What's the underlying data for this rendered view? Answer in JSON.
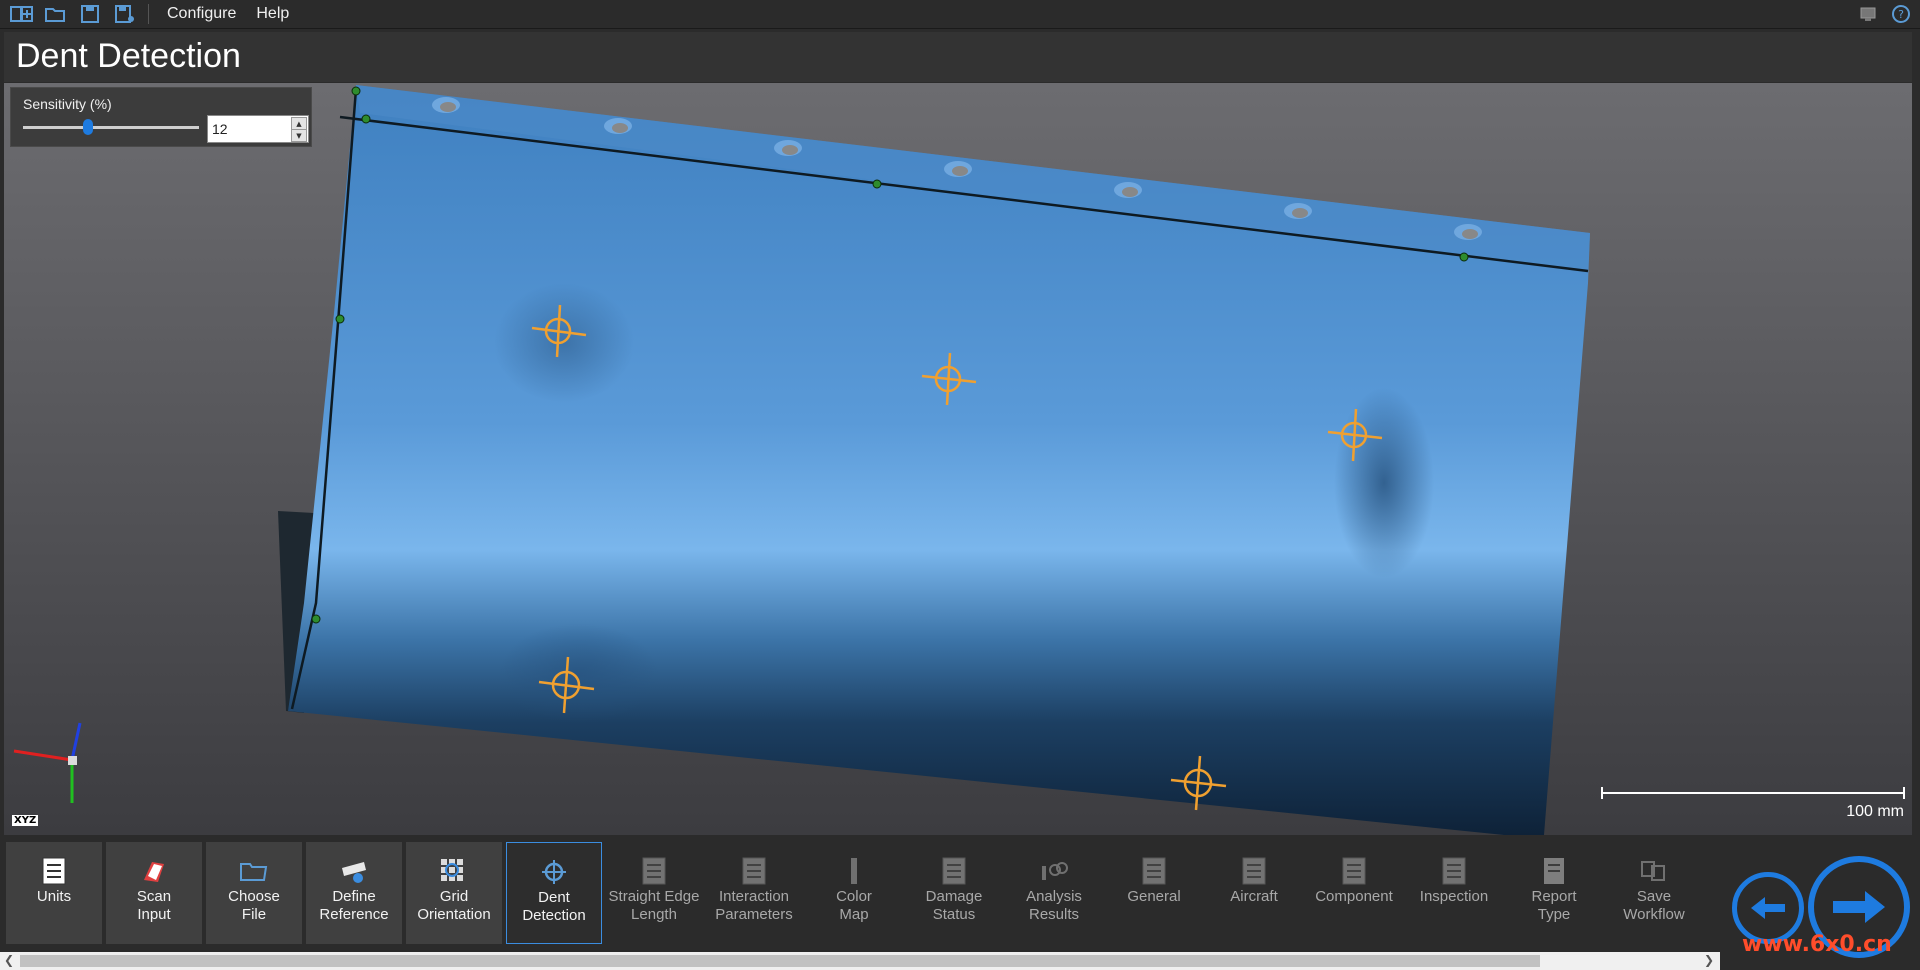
{
  "menu": {
    "items": [
      "Configure",
      "Help"
    ],
    "icons": [
      "new-project-icon",
      "open-folder-icon",
      "save-icon",
      "save-as-icon"
    ]
  },
  "page": {
    "title": "Dent Detection"
  },
  "sensitivity": {
    "label": "Sensitivity (%)",
    "value": "12",
    "slider_fraction": 0.36
  },
  "viewport": {
    "scale_label": "100 mm",
    "axis_label": "XYZ"
  },
  "toolbar": {
    "tools": [
      {
        "id": "units",
        "label": "Units",
        "state": "enabled"
      },
      {
        "id": "scan-input",
        "label": "Scan\nInput",
        "state": "enabled"
      },
      {
        "id": "choose-file",
        "label": "Choose\nFile",
        "state": "enabled"
      },
      {
        "id": "define-reference",
        "label": "Define\nReference",
        "state": "enabled"
      },
      {
        "id": "grid-orientation",
        "label": "Grid\nOrientation",
        "state": "enabled"
      },
      {
        "id": "dent-detection",
        "label": "Dent\nDetection",
        "state": "selected"
      },
      {
        "id": "straight-edge-length",
        "label": "Straight Edge\nLength",
        "state": "disabled"
      },
      {
        "id": "interaction-parameters",
        "label": "Interaction\nParameters",
        "state": "disabled"
      },
      {
        "id": "color-map",
        "label": "Color\nMap",
        "state": "disabled"
      },
      {
        "id": "damage-status",
        "label": "Damage\nStatus",
        "state": "disabled"
      },
      {
        "id": "analysis-results",
        "label": "Analysis\nResults",
        "state": "disabled"
      },
      {
        "id": "general",
        "label": "General",
        "state": "disabled"
      },
      {
        "id": "aircraft",
        "label": "Aircraft",
        "state": "disabled"
      },
      {
        "id": "component",
        "label": "Component",
        "state": "disabled"
      },
      {
        "id": "inspection",
        "label": "Inspection",
        "state": "disabled"
      },
      {
        "id": "report-type",
        "label": "Report\nType",
        "state": "disabled"
      },
      {
        "id": "save-workflow",
        "label": "Save\nWorkflow",
        "state": "disabled"
      }
    ]
  },
  "watermark": "www.6x0.cn",
  "colors": {
    "accent": "#1e7be0",
    "surface": "#4a8ccc",
    "marker": "#f0a030"
  }
}
